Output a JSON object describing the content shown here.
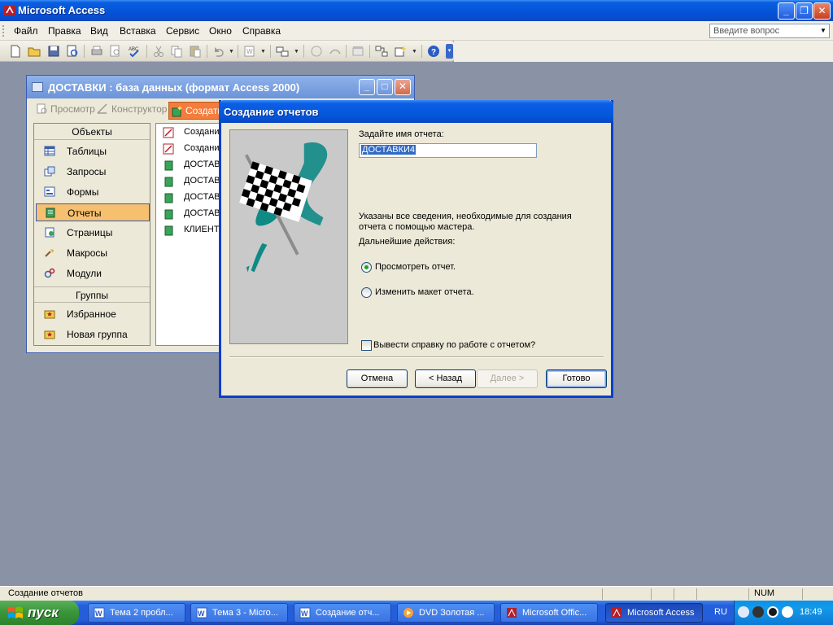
{
  "app": {
    "title": "Microsoft Access"
  },
  "menu": {
    "items": [
      "Файл",
      "Правка",
      "Вид",
      "Вставка",
      "Сервис",
      "Окно",
      "Справка"
    ],
    "ask_placeholder": "Введите вопрос"
  },
  "db_window": {
    "title": "ДОСТАВКИ : база данных (формат Access 2000)",
    "toolbar": {
      "preview": "Просмотр",
      "designer": "Конструктор",
      "create": "Создать"
    },
    "objects_header": "Объекты",
    "objects": [
      "Таблицы",
      "Запросы",
      "Формы",
      "Отчеты",
      "Страницы",
      "Макросы",
      "Модули"
    ],
    "selected_object": "Отчеты",
    "groups_header": "Группы",
    "groups": [
      "Избранное",
      "Новая группа"
    ],
    "list": [
      "Создани",
      "Создани",
      "ДОСТАВ",
      "ДОСТАВ",
      "ДОСТАВ",
      "ДОСТАВ",
      "КЛИЕНТ"
    ]
  },
  "dialog": {
    "title": "Создание отчетов",
    "name_label": "Задайте имя отчета:",
    "name_value": "ДОСТАВКИ4",
    "info_line1": "Указаны все сведения, необходимые для создания",
    "info_line2": "отчета с помощью мастера.",
    "next_actions": "Дальнейшие действия:",
    "option_preview": "Просмотреть отчет.",
    "option_modify": "Изменить макет отчета.",
    "selected_option": "preview",
    "help_checkbox": "Вывести справку по работе с отчетом?",
    "help_checked": false,
    "buttons": {
      "cancel": "Отмена",
      "back": "< Назад",
      "next": "Далее >",
      "finish": "Готово"
    }
  },
  "statusbar": {
    "text": "Создание отчетов",
    "num": "NUM"
  },
  "taskbar": {
    "start": "пуск",
    "tasks": [
      "Тема 2 пробл...",
      "Тема 3 - Micro...",
      "Создание отч...",
      "DVD  Золотая ...",
      "Microsoft Offic...",
      "Microsoft Access"
    ],
    "active_task": "Microsoft Access",
    "language": "RU",
    "clock": "18:49"
  },
  "colors": {
    "desktop": "#8a93a6",
    "title_blue": "#0453d8",
    "selected_object_bg": "#f7c06e",
    "create_button": "#f47c3c"
  }
}
